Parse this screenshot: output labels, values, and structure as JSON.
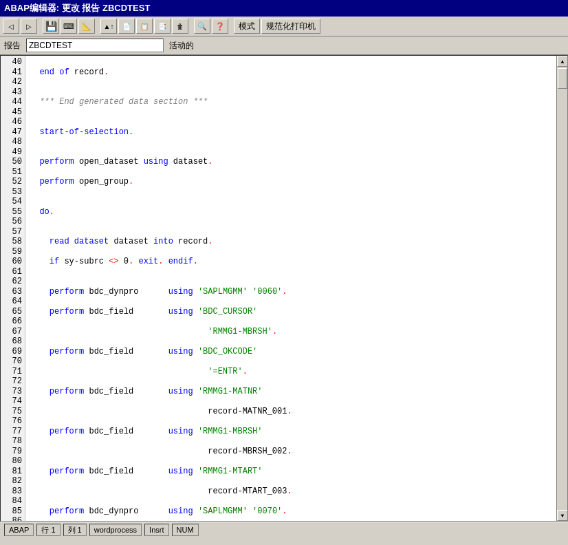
{
  "titleBar": {
    "text": "ABAP编辑器: 更改 报告 ZBCDTEST"
  },
  "toolbar": {
    "buttons": [
      "◁",
      "▷",
      "💾",
      "📋",
      "🖨",
      "↩",
      "↪",
      "📄",
      "📑",
      "🔍",
      "❓"
    ],
    "textButtons": [
      "模式",
      "规范化打印机"
    ]
  },
  "reportBar": {
    "label": "报告",
    "value": "ZBCDTEST",
    "status": "活动的"
  },
  "statusBar": {
    "lang": "ABAP",
    "row": "行  1",
    "col": "列  1",
    "mode1": "wordprocess",
    "mode2": "Insrt",
    "mode3": "NUM"
  }
}
